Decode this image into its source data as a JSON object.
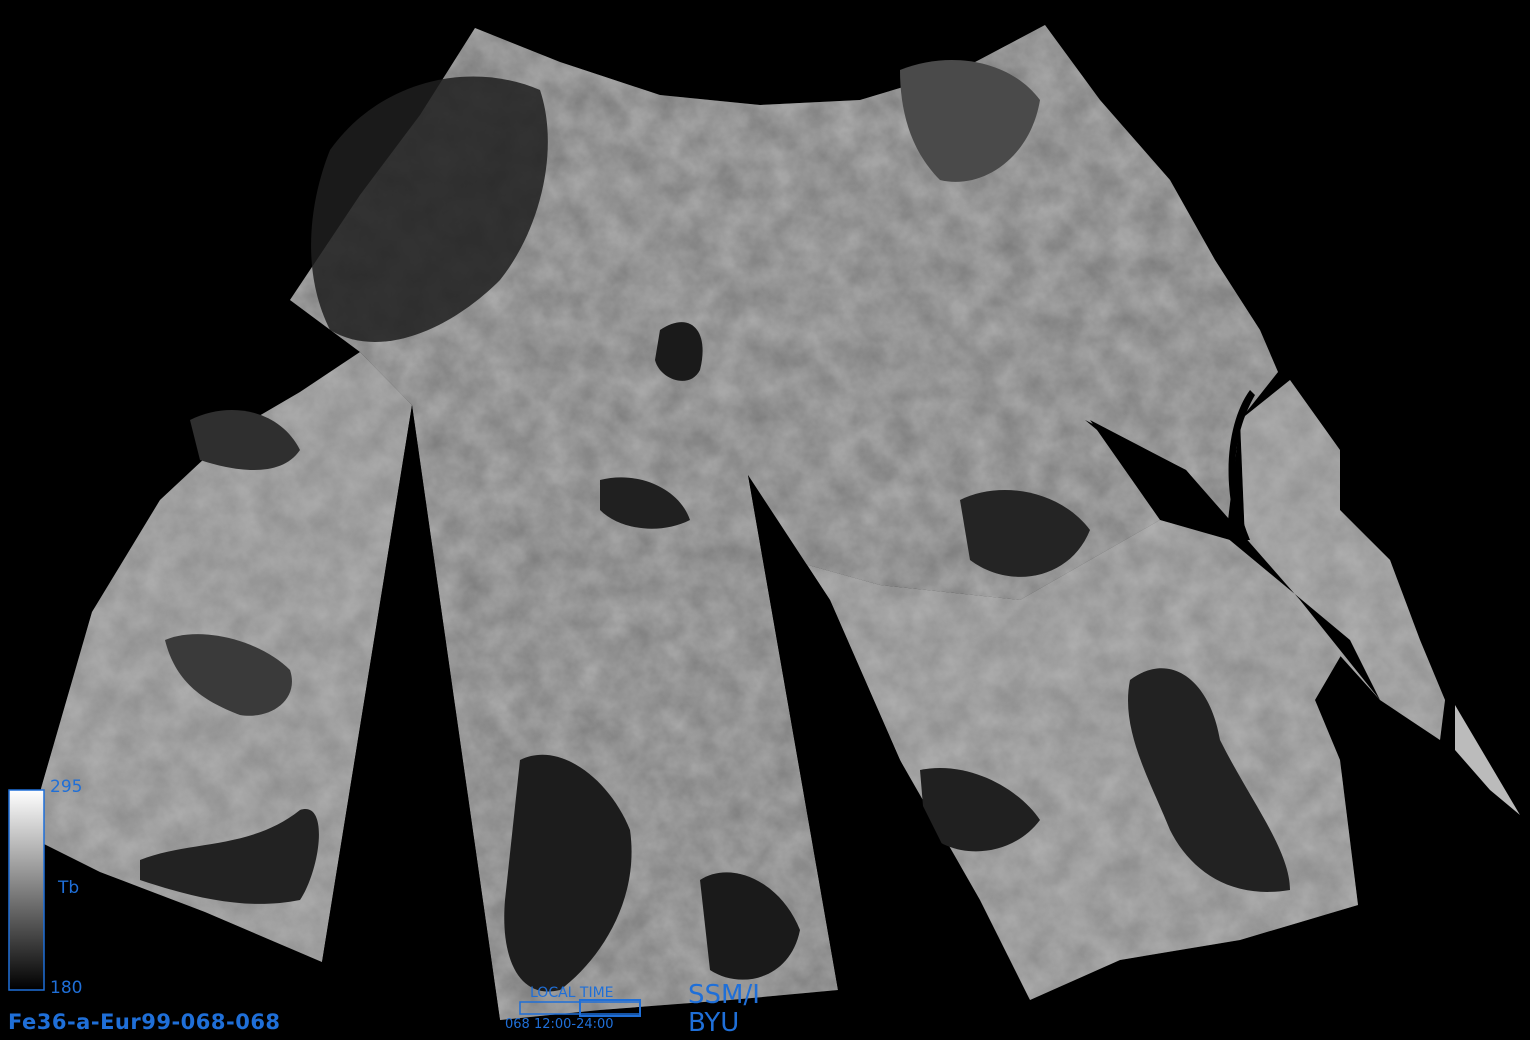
{
  "image": {
    "kind": "SSM/I brightness temperature swath mosaic",
    "region": "Europe",
    "palette": "grayscale",
    "colors": {
      "background": "#000000",
      "annotation": "#1f6fd8"
    }
  },
  "colorbar": {
    "max_label": "295",
    "min_label": "180",
    "variable_label": "Tb"
  },
  "file_id": "Fe36-a-Eur99-068-068",
  "local_time": {
    "title": "LOCAL TIME",
    "range_label": "068 12:00-24:00",
    "window_fraction": 0.5
  },
  "sensor": "SSM/I",
  "organization": "BYU"
}
